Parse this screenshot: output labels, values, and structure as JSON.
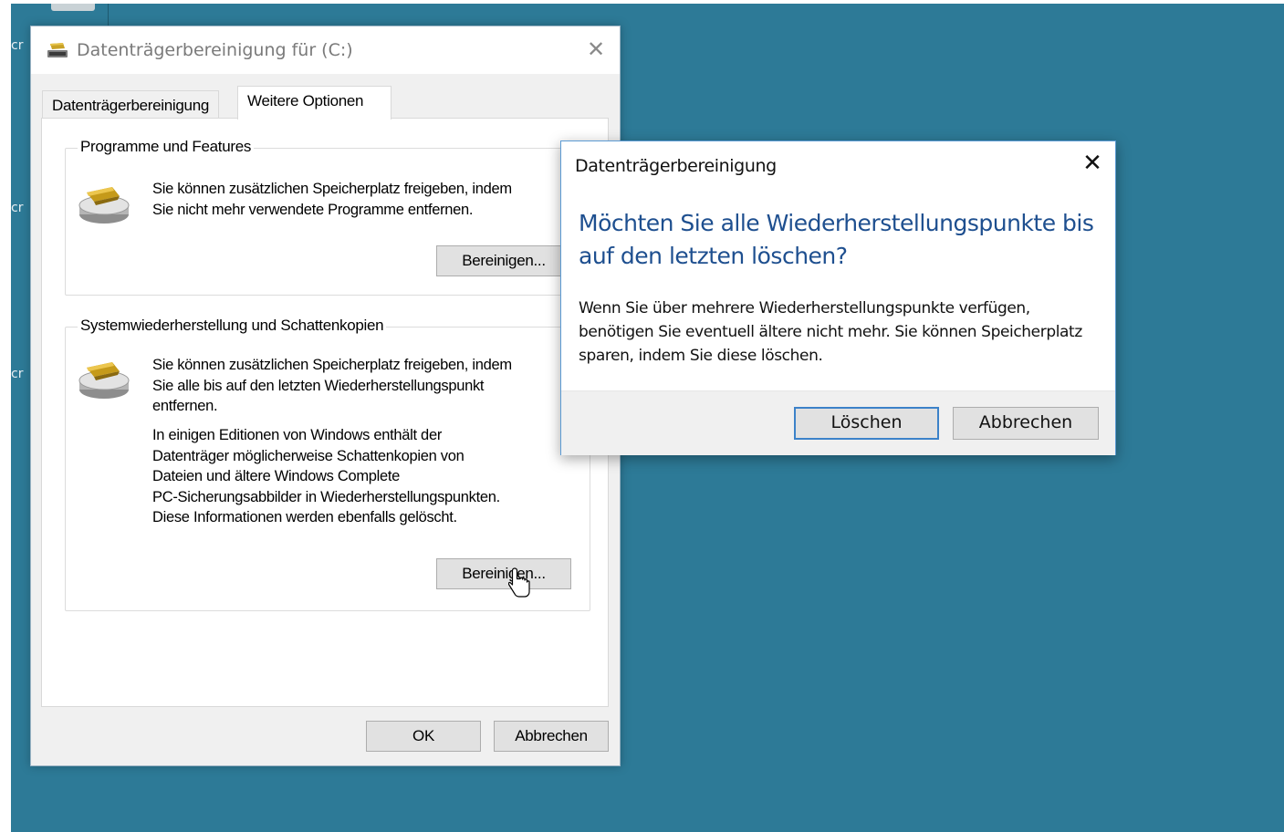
{
  "desktop": {
    "fragments": [
      "cr",
      "cr",
      "cr"
    ]
  },
  "main_window": {
    "title": "Datenträgerbereinigung für  (C:)",
    "close_glyph": "✕",
    "tabs": [
      {
        "label": "Datenträgerbereinigung",
        "active": false
      },
      {
        "label": "Weitere Optionen",
        "active": true
      }
    ],
    "groups": [
      {
        "legend": "Programme und Features",
        "text": "Sie können zusätzlichen Speicherplatz freigeben, indem\nSie nicht mehr verwendete Programme entfernen.",
        "button": "Bereinigen..."
      },
      {
        "legend": "Systemwiederherstellung und Schattenkopien",
        "text": "Sie können zusätzlichen Speicherplatz freigeben, indem\nSie alle bis auf den letzten Wiederherstellungspunkt\nentfernen.",
        "text2": "In einigen Editionen von Windows enthält der\nDatenträger möglicherweise Schattenkopien von\nDateien und ältere Windows Complete\nPC-Sicherungsabbilder in Wiederherstellungspunkten.\nDiese Informationen werden ebenfalls gelöscht.",
        "button": "Bereinigen..."
      }
    ],
    "ok_label": "OK",
    "cancel_label": "Abbrechen"
  },
  "dialog": {
    "title": "Datenträgerbereinigung",
    "close_glyph": "✕",
    "heading": "Möchten Sie alle Wiederherstellungspunkte bis auf den letzten löschen?",
    "body": "Wenn Sie über mehrere Wiederherstellungspunkte verfügen, benötigen Sie eventuell ältere nicht mehr. Sie können Speicherplatz sparen, indem Sie diese löschen.",
    "delete_label": "Löschen",
    "cancel_label": "Abbrechen"
  },
  "colors": {
    "desktop": "#2d7a97",
    "dialog_heading": "#1e4f8f",
    "focus_border": "#3c82c9"
  }
}
